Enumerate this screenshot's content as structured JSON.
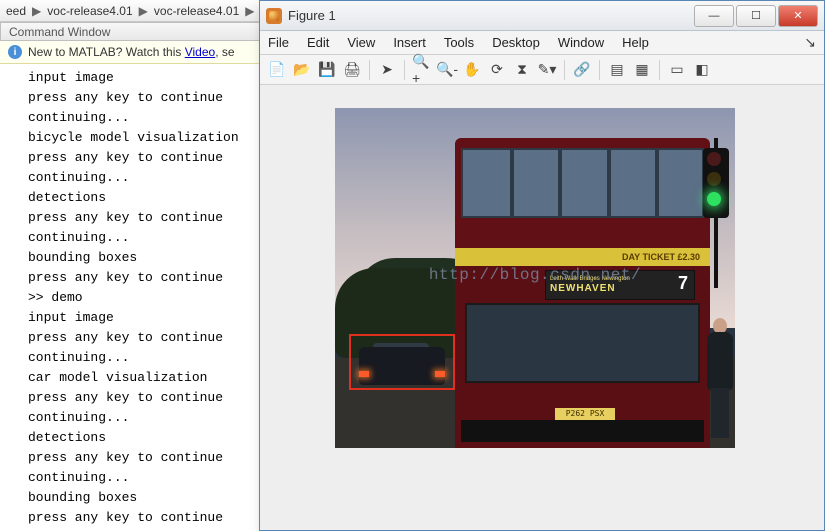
{
  "pathbar": {
    "seg0": "eed",
    "seg1": "voc-release4.01",
    "seg2": "voc-release4.01"
  },
  "matlab": {
    "cmdwin_title": "Command Window",
    "banner_prefix": "New to MATLAB? Watch this ",
    "banner_link": "Video",
    "banner_suffix": ", se"
  },
  "console_lines": [
    "input image",
    "press any key to continue",
    "continuing...",
    "bicycle model visualization",
    "press any key to continue",
    "continuing...",
    "detections",
    "press any key to continue",
    "continuing...",
    "bounding boxes",
    "press any key to continue",
    ">> demo",
    "input image",
    "press any key to continue",
    "continuing...",
    "car model visualization",
    "press any key to continue",
    "continuing...",
    "detections",
    "press any key to continue",
    "continuing...",
    "bounding boxes",
    "press any key to continue"
  ],
  "figure": {
    "title": "Figure 1",
    "menus": [
      "File",
      "Edit",
      "View",
      "Insert",
      "Tools",
      "Desktop",
      "Window",
      "Help"
    ],
    "dest_band": "DAY TICKET     £2.30",
    "dest_top": "Leith Walk Bridges Newington",
    "dest_main": "NEWHAVEN",
    "route_no": "7",
    "plate": "P262 PSX",
    "watermark": "http://blog.csdn.net/"
  }
}
